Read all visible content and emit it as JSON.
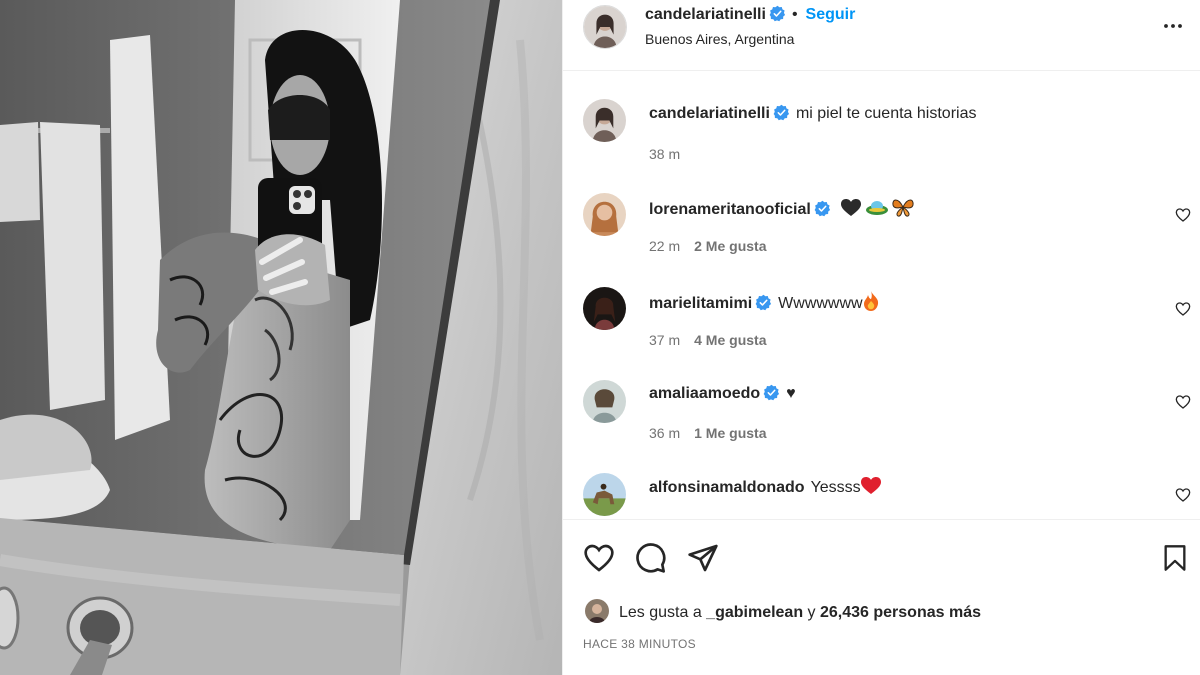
{
  "post": {
    "username": "candelariatinelli",
    "follow_label": "Seguir",
    "dot": "•",
    "location": "Buenos Aires, Argentina",
    "more_icon": "more-horizontal-icon"
  },
  "caption": {
    "username": "candelariatinelli",
    "text": "mi piel te cuenta historias",
    "time": "38 m"
  },
  "comments": [
    {
      "username": "lorenameritanooficial",
      "verified": true,
      "text": "",
      "emojis": [
        "black-heart",
        "flying-saucer",
        "butterfly"
      ],
      "time": "22 m",
      "likes": "2 Me gusta"
    },
    {
      "username": "marielitamimi",
      "verified": true,
      "text": "Wwwwwww",
      "emojis": [
        "fire"
      ],
      "time": "37 m",
      "likes": "4 Me gusta"
    },
    {
      "username": "amaliaamoedo",
      "verified": true,
      "text": "♥",
      "emojis": [],
      "time": "36 m",
      "likes": "1 Me gusta"
    },
    {
      "username": "alfonsinamaldonado",
      "verified": false,
      "text": "Yessss",
      "emojis": [
        "red-heart"
      ],
      "time": "",
      "likes": ""
    }
  ],
  "likes": {
    "prefix": "Les gusta a ",
    "user": "_gabimelean",
    "middle": " y ",
    "count": "26,436 personas más"
  },
  "time_ago": "HACE 38 MINUTOS",
  "colors": {
    "accent": "#0095f6",
    "verified": "#3897f0",
    "text": "#262626",
    "secondary": "#737373",
    "border": "#efefef"
  }
}
